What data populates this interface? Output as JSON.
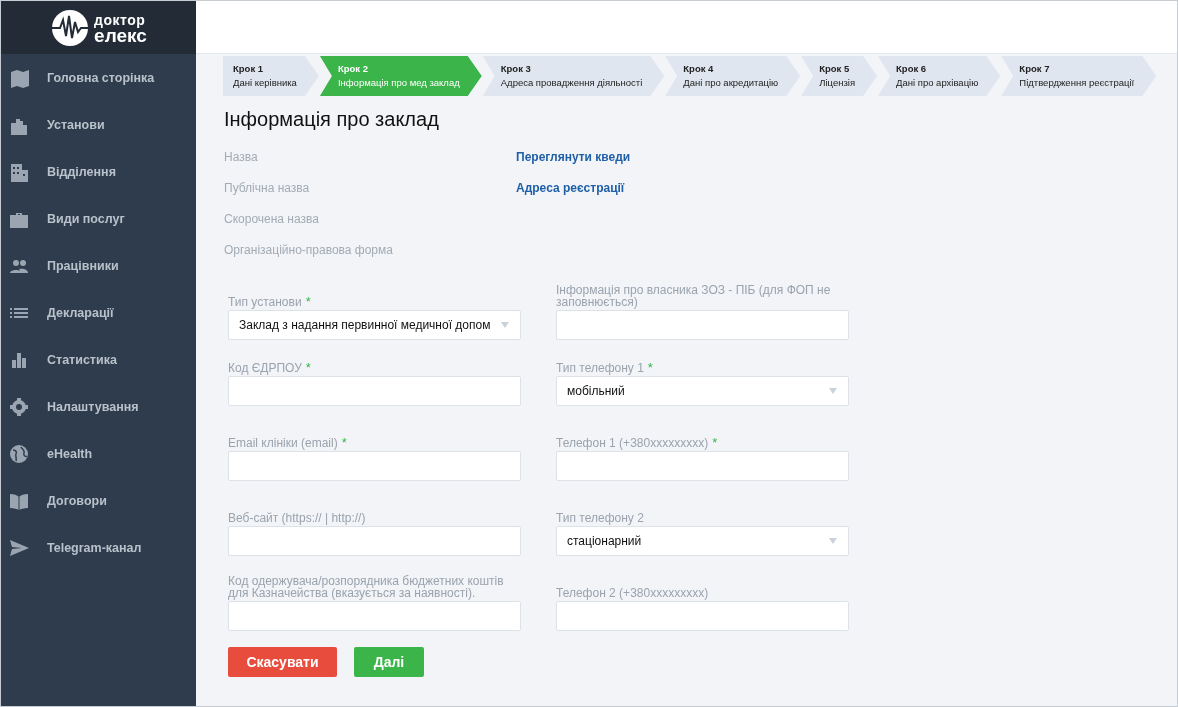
{
  "logo": {
    "line1": "доктор",
    "line2": "елекс"
  },
  "sidebar": {
    "items": [
      {
        "label": "Головна сторінка"
      },
      {
        "label": "Установи"
      },
      {
        "label": "Відділення"
      },
      {
        "label": "Види послуг"
      },
      {
        "label": "Працівники"
      },
      {
        "label": "Декларації"
      },
      {
        "label": "Статистика"
      },
      {
        "label": "Налаштування"
      },
      {
        "label": "eHealth"
      },
      {
        "label": "Договори"
      },
      {
        "label": "Telegram-канал"
      }
    ]
  },
  "steps": [
    {
      "step": "Крок 1",
      "label": "Дані керівника",
      "selected": false
    },
    {
      "step": "Крок 2",
      "label": "Інформація про мед заклад",
      "selected": true
    },
    {
      "step": "Крок 3",
      "label": "Адреса провадження діяльності",
      "selected": false
    },
    {
      "step": "Крок 4",
      "label": "Дані про акредитацію",
      "selected": false
    },
    {
      "step": "Крок 5",
      "label": "Ліцензія",
      "selected": false
    },
    {
      "step": "Крок 6",
      "label": "Дані про архівацію",
      "selected": false
    },
    {
      "step": "Крок 7",
      "label": "Підтвердження реєстрації",
      "selected": false
    }
  ],
  "title": "Інформація про заклад",
  "info_labels": [
    "Назва",
    "Публічна назва",
    "Скорочена назва",
    "Організаційно-правова форма"
  ],
  "links": [
    "Переглянути кведи",
    "Адреса реєстрації"
  ],
  "fields_left": [
    {
      "label": "Тип установи",
      "required_mark": "*",
      "kind": "select",
      "value": "Заклад з надання первинної медичної допом"
    },
    {
      "label": "Код ЄДРПОУ",
      "required_mark": "*",
      "kind": "input"
    },
    {
      "label": "Email клініки (email)",
      "required_mark": "*",
      "kind": "input"
    },
    {
      "label": "Веб-сайт (https:// | http://)",
      "kind": "input"
    },
    {
      "label": "Код одержувача/розпорядника бюджетних коштів для Казначейства (вказується за наявності).",
      "kind": "input"
    }
  ],
  "fields_right": [
    {
      "label": "Інформація про власника ЗОЗ - ПІБ (для ФОП не заповнюється)",
      "kind": "input"
    },
    {
      "label": "Тип телефону 1",
      "required_mark": "*",
      "kind": "select",
      "value": "мобільний"
    },
    {
      "label": "Телефон 1 (+380xxxxxxxxx)",
      "required_mark": "*",
      "kind": "input"
    },
    {
      "label": "Тип телефону 2",
      "kind": "select",
      "value": "стаціонарний"
    },
    {
      "label": "Телефон 2 (+380xxxxxxxxx)",
      "kind": "input"
    }
  ],
  "buttons": [
    {
      "label": "Скасувати",
      "kind": "cancel"
    },
    {
      "label": "Далі",
      "kind": "next"
    }
  ]
}
